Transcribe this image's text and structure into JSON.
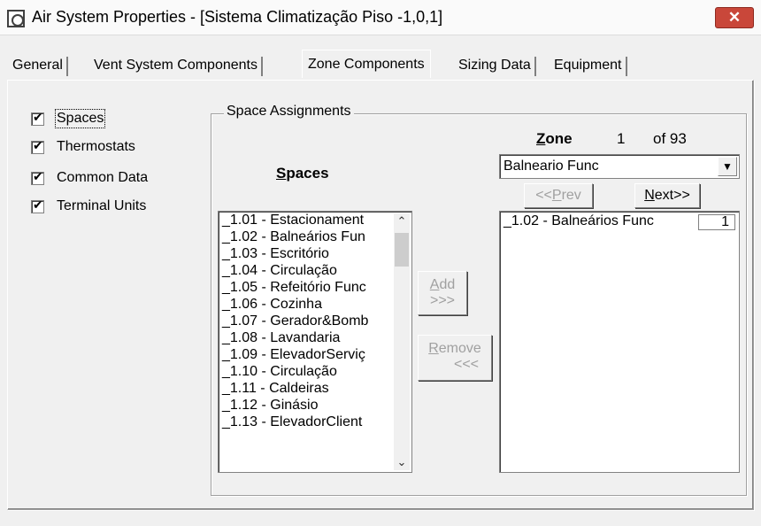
{
  "window": {
    "title": "Air System Properties - [Sistema Climatização Piso -1,0,1]",
    "close_label": "✕"
  },
  "tabs": [
    {
      "label": "General"
    },
    {
      "label": "Vent System Components"
    },
    {
      "label": "Zone Components",
      "active": true
    },
    {
      "label": "Sizing Data"
    },
    {
      "label": "Equipment"
    }
  ],
  "options": [
    {
      "label": "Spaces",
      "checked": true
    },
    {
      "label": "Thermostats",
      "checked": true
    },
    {
      "label": "Common Data",
      "checked": true
    },
    {
      "label": "Terminal Units",
      "checked": true
    }
  ],
  "space_assignments": {
    "legend": "Space Assignments",
    "spaces_heading_accel": "S",
    "spaces_heading_rest": "paces",
    "spaces": [
      "_1.01 - Estacionament",
      "_1.02 - Balneários Fun",
      "_1.03 - Escritório",
      "_1.04 - Circulação",
      "_1.05 - Refeitório Func",
      "_1.06 - Cozinha",
      "_1.07 - Gerador&Bomb",
      "_1.08 - Lavandaria",
      "_1.09 - ElevadorServiç",
      "_1.10 - Circulação",
      "_1.11 - Caldeiras",
      "_1.12 - Ginásio",
      "_1.13 - ElevadorClient"
    ],
    "add_accel": "A",
    "add_rest": "dd",
    "add_arrows": ">>>",
    "remove_accel": "R",
    "remove_rest": "emove",
    "remove_arrows": "<<<"
  },
  "zone": {
    "label_accel": "Z",
    "label_rest": "one",
    "number": "1",
    "of_text": "of 93",
    "selected_zone": "Balneario Func",
    "prev_prefix": "<<",
    "prev_accel": "P",
    "prev_rest": "rev",
    "next_accel": "N",
    "next_rest": "ext>>",
    "assigned": [
      {
        "name": "_1.02 - Balneários Func",
        "qty": "1"
      }
    ]
  }
}
